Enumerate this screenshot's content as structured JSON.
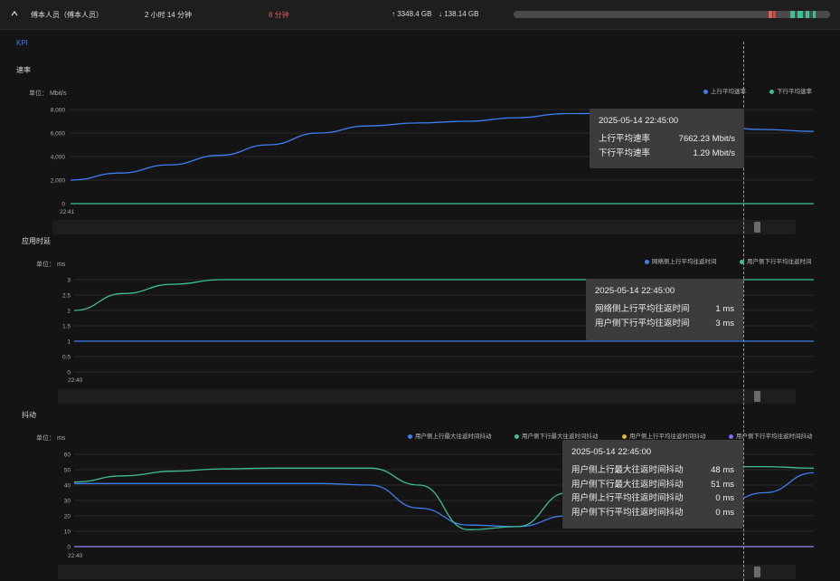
{
  "header": {
    "name": "傅本人员（傅本人员）",
    "duration": "2 小时 14 分钟",
    "alert": "8 分钟",
    "upload": "3348.4 GB",
    "download": "138.14 GB",
    "upload_arrow": "↑",
    "download_arrow": "↓"
  },
  "kpi_label": "KPI",
  "charts": [
    {
      "title": "速率",
      "unit": "单位：  Mbit/s",
      "legend": [
        "上行平均速率",
        "下行平均速率"
      ],
      "y_ticks": [
        "8,000",
        "6,000",
        "4,000",
        "2,000",
        "0"
      ],
      "x_start": "22:41",
      "tooltip": {
        "time": "2025-05-14 22:45:00",
        "rows": [
          {
            "label": "上行平均速率",
            "value": "7662.23 Mbit/s"
          },
          {
            "label": "下行平均速率",
            "value": "1.29 Mbit/s"
          }
        ]
      }
    },
    {
      "title": "应用时延",
      "unit": "单位：  ms",
      "legend": [
        "网络侧上行平均往返时间",
        "用户侧下行平均往返时间"
      ],
      "y_ticks": [
        "3",
        "2.5",
        "2",
        "1.5",
        "1",
        "0.5",
        "0"
      ],
      "x_start": "22:40",
      "tooltip": {
        "time": "2025-05-14 22:45:00",
        "rows": [
          {
            "label": "网络侧上行平均往返时间",
            "value": "1 ms"
          },
          {
            "label": "用户侧下行平均往返时间",
            "value": "3 ms"
          }
        ]
      }
    },
    {
      "title": "抖动",
      "unit": "单位：  ms",
      "legend": [
        "用户侧上行最大往返时间抖动",
        "用户侧下行最大往返时间抖动",
        "用户侧上行平均往返时间抖动",
        "用户侧下行平均往返时间抖动"
      ],
      "y_ticks": [
        "60",
        "50",
        "40",
        "30",
        "20",
        "10",
        "0"
      ],
      "x_start": "22:40",
      "tooltip": {
        "time": "2025-05-14 22:45:00",
        "rows": [
          {
            "label": "用户侧上行最大往返时间抖动",
            "value": "48 ms"
          },
          {
            "label": "用户侧下行最大往返时间抖动",
            "value": "51 ms"
          },
          {
            "label": "用户侧上行平均往返时间抖动",
            "value": "0 ms"
          },
          {
            "label": "用户侧下行平均往返时间抖动",
            "value": "0 ms"
          }
        ]
      }
    }
  ],
  "colors": {
    "blue": "#3d7ef0",
    "green": "#3fbf8f",
    "yellow": "#e7b53a",
    "purple": "#7b6cf0",
    "alert": "#e05a5a"
  },
  "chart_data": [
    {
      "type": "line",
      "title": "速率",
      "ylabel": "Mbit/s",
      "ylim": [
        0,
        8000
      ],
      "series": [
        {
          "name": "上行平均速率",
          "values": [
            2000,
            2600,
            3300,
            4100,
            5000,
            6000,
            6600,
            6850,
            7000,
            7300,
            7650,
            7662,
            6800,
            6500,
            6300,
            6150
          ]
        },
        {
          "name": "下行平均速率",
          "values": [
            1.3,
            1.3,
            1.3,
            1.3,
            1.3,
            1.3,
            1.3,
            1.3,
            1.3,
            1.3,
            1.3,
            1.29,
            1.3,
            1.3,
            1.3,
            1.3
          ]
        }
      ]
    },
    {
      "type": "line",
      "title": "应用时延",
      "ylabel": "ms",
      "ylim": [
        0,
        3
      ],
      "series": [
        {
          "name": "网络侧上行平均往返时间",
          "values": [
            1,
            1,
            1,
            1,
            1,
            1,
            1,
            1,
            1,
            1,
            1,
            1,
            1,
            1,
            1,
            1
          ]
        },
        {
          "name": "用户侧下行平均往返时间",
          "values": [
            2,
            2.55,
            2.85,
            3,
            3,
            3,
            3,
            3,
            3,
            3,
            3,
            3,
            3,
            3,
            3,
            3
          ]
        }
      ]
    },
    {
      "type": "line",
      "title": "抖动",
      "ylabel": "ms",
      "ylim": [
        0,
        60
      ],
      "series": [
        {
          "name": "用户侧上行最大往返时间抖动",
          "values": [
            41,
            41,
            41,
            41,
            41,
            41,
            40,
            25,
            14,
            13,
            20,
            48,
            40,
            25,
            35,
            48
          ]
        },
        {
          "name": "用户侧下行最大往返时间抖动",
          "values": [
            42,
            46,
            49,
            50.5,
            51,
            51,
            51,
            40,
            11,
            13,
            35,
            51,
            52,
            52,
            52,
            51
          ]
        },
        {
          "name": "用户侧上行平均往返时间抖动",
          "values": [
            0,
            0,
            0,
            0,
            0,
            0,
            0,
            0,
            0,
            0,
            0,
            0,
            0,
            0,
            0,
            0
          ]
        },
        {
          "name": "用户侧下行平均往返时间抖动",
          "values": [
            0,
            0,
            0,
            0,
            0,
            0,
            0,
            0,
            0,
            0,
            0,
            0,
            0,
            0,
            0,
            0
          ]
        }
      ]
    }
  ]
}
